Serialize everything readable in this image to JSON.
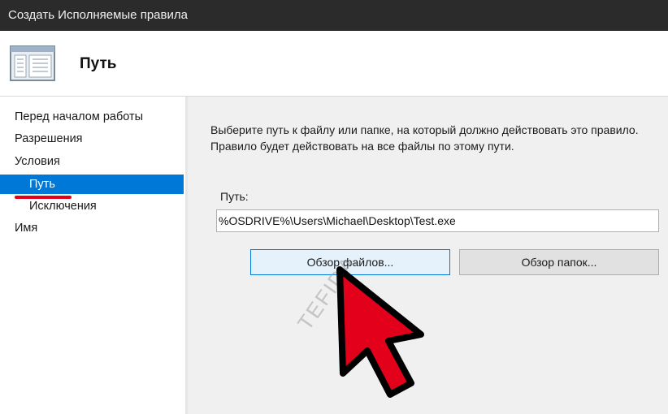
{
  "window": {
    "title": "Создать Исполняемые правила"
  },
  "header": {
    "title": "Путь",
    "icon": "window-list-icon"
  },
  "sidebar": {
    "items": [
      {
        "label": "Перед началом работы",
        "level": 1,
        "active": false
      },
      {
        "label": "Разрешения",
        "level": 1,
        "active": false
      },
      {
        "label": "Условия",
        "level": 1,
        "active": false
      },
      {
        "label": "Путь",
        "level": 2,
        "active": true
      },
      {
        "label": "Исключения",
        "level": 2,
        "active": false
      },
      {
        "label": "Имя",
        "level": 1,
        "active": false
      }
    ]
  },
  "content": {
    "description_line1": "Выберите путь к файлу или папке, на который должно действовать это правило.",
    "description_line2": "Правило будет действовать на все файлы по этому пути.",
    "path_label": "Путь:",
    "path_value": "%OSDRIVE%\\Users\\Michael\\Desktop\\Test.exe",
    "browse_files_label": "Обзор файлов...",
    "browse_folders_label": "Обзор папок..."
  },
  "overlay": {
    "watermark": "TEFIDA"
  },
  "colors": {
    "titlebar": "#2b2b2b",
    "accent": "#0078d7",
    "annotation_red": "#e3001b",
    "content_bg": "#f0f0f0"
  }
}
